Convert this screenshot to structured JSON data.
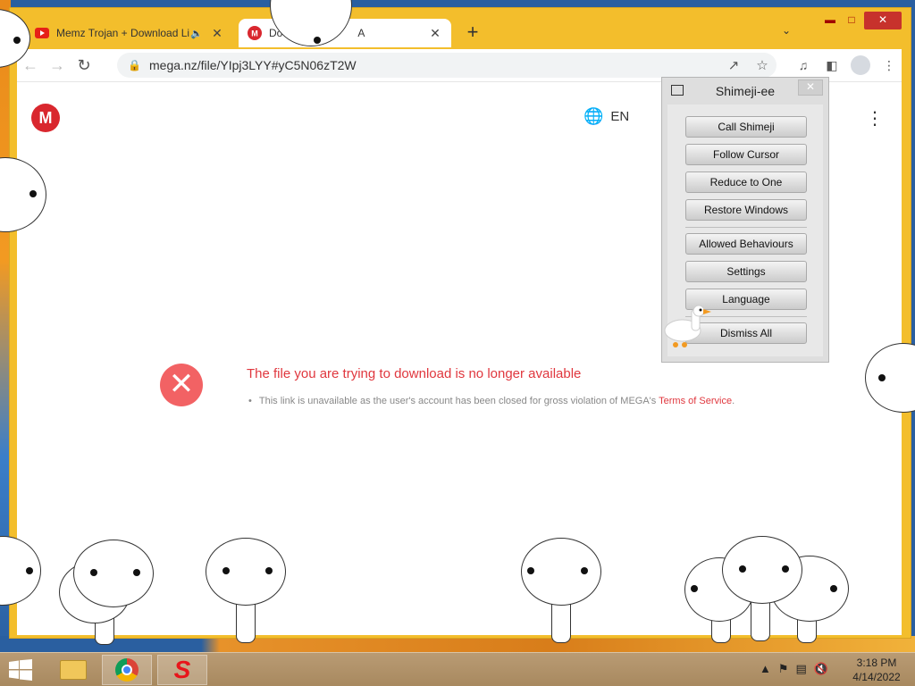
{
  "browser": {
    "tabs": [
      {
        "title": "Memz Trojan + Download Li",
        "favicon": "youtube-icon",
        "audio": true,
        "active": false
      },
      {
        "title": "Dov",
        "title_suffix": "A",
        "favicon": "mega-icon",
        "active": true
      }
    ],
    "url": "mega.nz/file/YIpj3LYY#yC5N06zT2W"
  },
  "page": {
    "logo": "M",
    "language": "EN",
    "error_title": "The file you are trying to download is no longer available",
    "error_detail": "This link is unavailable as the user's account has been closed for gross violation of MEGA's",
    "error_link": "Terms of Service",
    "error_end": "."
  },
  "shimeji_menu": {
    "title": "Shimeji-ee",
    "buttons": [
      "Call Shimeji",
      "Follow Cursor",
      "Reduce to One",
      "Restore Windows",
      "Allowed Behaviours",
      "Settings",
      "Language",
      "Dismiss All"
    ]
  },
  "taskbar": {
    "time": "3:18 PM",
    "date": "4/14/2022"
  },
  "colors": {
    "window_frame": "#f3be2c",
    "mega_red": "#d9272e",
    "error_red": "#e0373e"
  }
}
